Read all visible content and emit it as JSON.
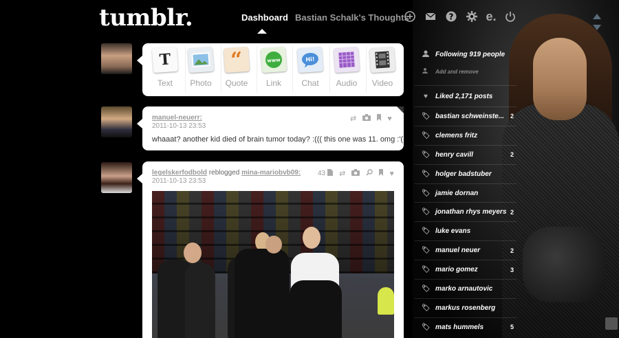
{
  "header": {
    "logo": "tumblr.",
    "nav_dashboard": "Dashboard",
    "nav_blog": "Bastian Schalk's Thoughts",
    "icons": [
      "plus-icon",
      "mail-icon",
      "help-icon",
      "gear-icon",
      "e-icon",
      "power-icon"
    ]
  },
  "composer": {
    "types": [
      {
        "label": "Text",
        "icon": "text-icon",
        "color": "#fafafa",
        "glyph": "T"
      },
      {
        "label": "Photo",
        "icon": "photo-icon",
        "color": "#e9eef3",
        "glyph": ""
      },
      {
        "label": "Quote",
        "icon": "quote-icon",
        "color": "#f6e5cf",
        "glyph": "“"
      },
      {
        "label": "Link",
        "icon": "link-icon",
        "color": "#e7f2df",
        "glyph": "www"
      },
      {
        "label": "Chat",
        "icon": "chat-icon",
        "color": "#e3ecf7",
        "glyph": "Hi!"
      },
      {
        "label": "Audio",
        "icon": "audio-icon",
        "color": "#ece3f3",
        "glyph": ""
      },
      {
        "label": "Video",
        "icon": "video-icon",
        "color": "#ededed",
        "glyph": ""
      }
    ]
  },
  "posts": [
    {
      "author": "manuel-neuerr:",
      "date": "2011-10-13 23:53",
      "text": "whaaat? another kid died of brain tumor today? :((( this one was 11. omg :'("
    },
    {
      "author": "legelskerfodbold",
      "reblogged": "reblogged",
      "source": "mina-mariobvb09:",
      "date": "2011-10-13 23:53",
      "notes": "43"
    }
  ],
  "sidebar": {
    "following": "Following 919 people",
    "add_remove": "Add and remove",
    "liked": "Liked 2,171 posts",
    "tags": [
      {
        "name": "bastian schweinste...",
        "count": "2"
      },
      {
        "name": "clemens fritz",
        "count": ""
      },
      {
        "name": "henry cavill",
        "count": "2"
      },
      {
        "name": "holger badstuber",
        "count": ""
      },
      {
        "name": "jamie dornan",
        "count": ""
      },
      {
        "name": "jonathan rhys meyers",
        "count": "2"
      },
      {
        "name": "luke evans",
        "count": ""
      },
      {
        "name": "manuel neuer",
        "count": "2"
      },
      {
        "name": "mario gomez",
        "count": "3"
      },
      {
        "name": "marko arnautovic",
        "count": ""
      },
      {
        "name": "markus rosenberg",
        "count": ""
      },
      {
        "name": "mats hummels",
        "count": "5"
      }
    ]
  }
}
